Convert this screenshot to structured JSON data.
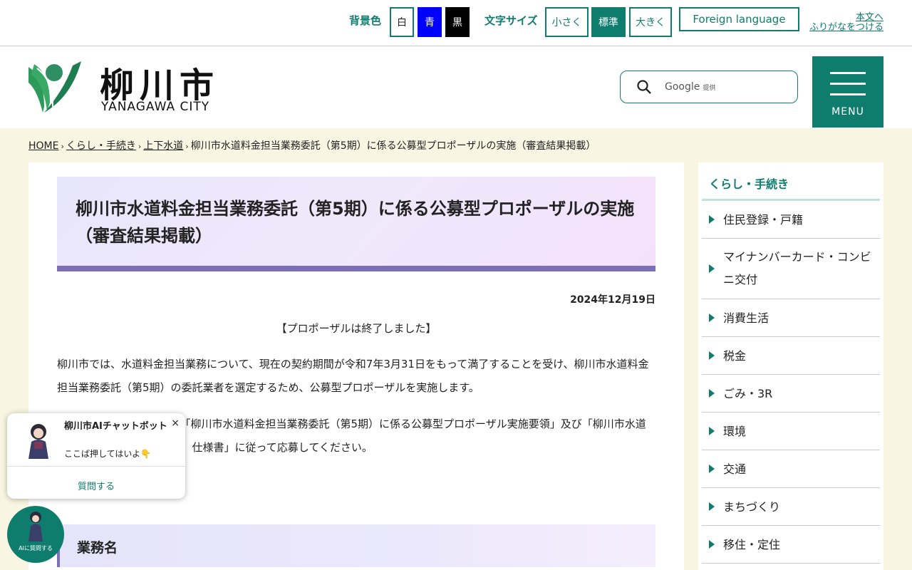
{
  "util": {
    "bg_label": "背景色",
    "bg_white": "白",
    "bg_blue": "青",
    "bg_black": "黒",
    "font_label": "文字サイズ",
    "font_small": "小さく",
    "font_standard": "標準",
    "font_large": "大きく",
    "foreign": "Foreign language",
    "furigana_line1": "本文へ",
    "furigana_line2": "ふりがなをつける",
    "colors": {
      "accent": "#0e7d6e",
      "blue": "#0000ff",
      "black": "#000000"
    }
  },
  "header": {
    "logo_jp": "柳川市",
    "logo_en": "YANAGAWA CITY",
    "search_placeholder": "Google",
    "search_provided": "提供",
    "menu_label": "MENU",
    "search_icon": "search-icon"
  },
  "breadcrumb": {
    "items": [
      "HOME",
      "くらし・手続き",
      "上下水道"
    ],
    "current": "柳川市水道料金担当業務委託（第5期）に係る公募型プロポーザルの実施（審査結果掲載）",
    "separator": "›"
  },
  "article": {
    "title": "柳川市水道料金担当業務委託（第5期）に係る公募型プロポーザルの実施（審査結果掲載）",
    "date": "2024年12月19日",
    "notice": "【プロポーザルは終了しました】",
    "para1": "柳川市では、水道料金担当業務について、現在の契約期間が令和7年3月31日をもって満了することを受け、柳川市水道料金担当業務委託（第5期）の委託業者を選定するため、公募型プロポーザルを実施します。",
    "para2": "応募を希望する事業者は、「柳川市水道料金担当業務委託（第5期）に係る公募型プロポーザル実施要領」及び「柳川市水道料金担当業務委託（第5期）仕様書」に従って応募してください。",
    "section1": "業務名"
  },
  "sidebar": {
    "heading": "くらし・手続き",
    "items": [
      "住民登録・戸籍",
      "マイナンバーカード・コンビニ交付",
      "消費生活",
      "税金",
      "ごみ・3R",
      "環境",
      "交通",
      "まちづくり",
      "移住・定住"
    ]
  },
  "chatbot": {
    "title": "柳川市AIチャットボット",
    "subtitle": "ここば押してはいよ👇",
    "close": "×",
    "ask": "質問する",
    "fab_label": "AIに質問する"
  }
}
